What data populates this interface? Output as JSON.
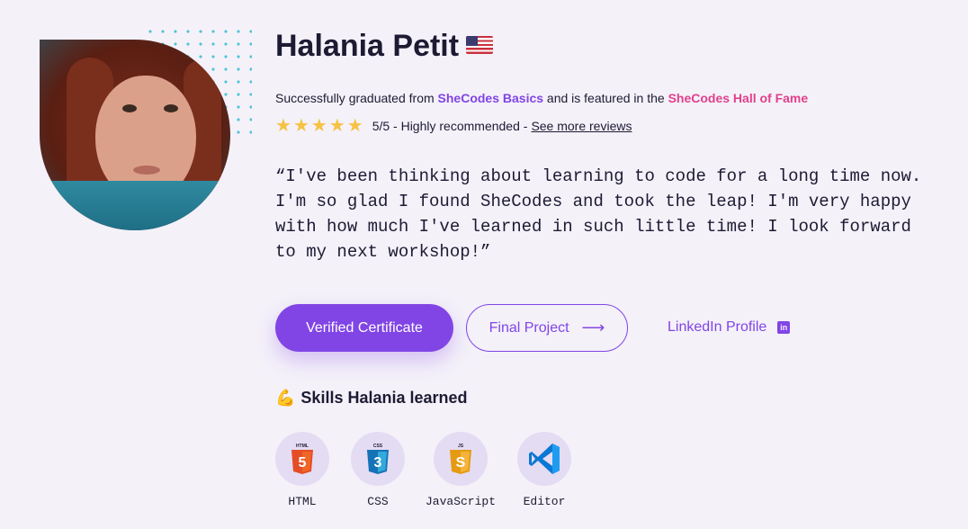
{
  "profile": {
    "name": "Halania Petit",
    "flag": "us-flag",
    "avatar": "profile-photo"
  },
  "graduation": {
    "prefix": "Successfully graduated from ",
    "program": "SheCodes Basics",
    "middle": " and is featured in the ",
    "hall": "SheCodes Hall of Fame"
  },
  "rating": {
    "stars": 5,
    "text": "5/5 - Highly recommended -",
    "more_link": "See more reviews"
  },
  "quote": "“I've been thinking about learning to code for a long time now. I'm so glad I found SheCodes and took the leap! I'm very happy with how much I've learned in such little time! I look forward to my next workshop!”",
  "actions": {
    "certificate": "Verified Certificate",
    "project": "Final Project",
    "project_icon": "arrow-right-icon",
    "linkedin": "LinkedIn Profile",
    "linkedin_icon": "linkedin-icon"
  },
  "skills": {
    "heading": "Skills Halania learned",
    "icon": "flexed-biceps-emoji",
    "items": [
      {
        "label": "HTML",
        "icon": "html5-icon",
        "badge": "HTML",
        "color": "#e44d26"
      },
      {
        "label": "CSS",
        "icon": "css3-icon",
        "badge": "CSS",
        "color": "#2965f1"
      },
      {
        "label": "JavaScript",
        "icon": "js-icon",
        "badge": "JS",
        "color": "#f0a41b"
      },
      {
        "label": "Editor",
        "icon": "vscode-icon",
        "color": "#0a78d4"
      }
    ]
  },
  "colors": {
    "accent": "#8145e5",
    "pink": "#e2408c",
    "background": "#f4f1f9",
    "star": "#f6c244"
  }
}
